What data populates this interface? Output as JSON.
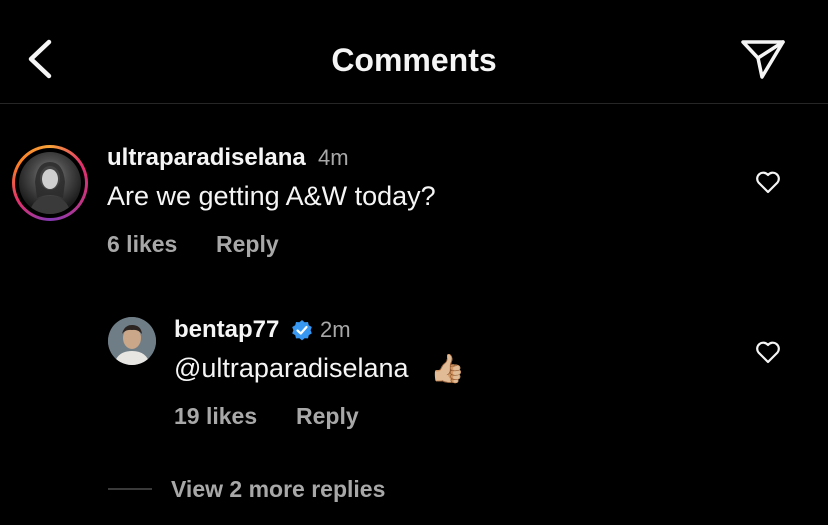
{
  "header": {
    "title": "Comments",
    "back_icon": "chevron-left-icon",
    "share_icon": "paper-plane-icon"
  },
  "comments": [
    {
      "username": "ultraparadiselana",
      "time": "4m",
      "text": "Are we getting A&W today?",
      "likes": "6 likes",
      "reply_label": "Reply",
      "has_story_ring": true
    },
    {
      "username": "bentap77",
      "verified": true,
      "time": "2m",
      "text": "@ultraparadiselana",
      "emoji": "👍🏼",
      "likes": "19 likes",
      "reply_label": "Reply"
    }
  ],
  "view_more_replies": "View 2 more replies",
  "colors": {
    "background": "#000000",
    "primary_text": "#f5f5f5",
    "secondary_text": "#a8a8a8",
    "verified_blue": "#3897f0"
  }
}
